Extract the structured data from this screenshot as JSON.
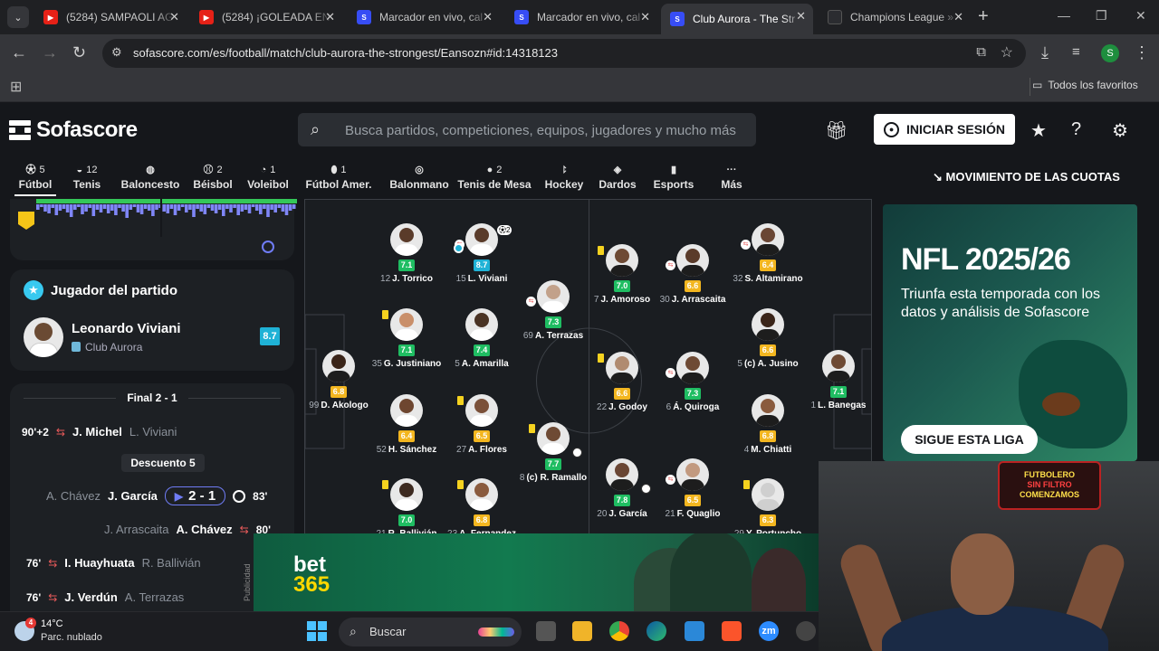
{
  "browser": {
    "tabs": [
      {
        "title": "(5284) SAMPAOLI AG",
        "icon": "youtube-icon"
      },
      {
        "title": "(5284) ¡GOLEADA EN",
        "icon": "youtube-icon"
      },
      {
        "title": "Marcador en vivo, cal",
        "icon": "sofascore-icon"
      },
      {
        "title": "Marcador en vivo, cal",
        "icon": "sofascore-icon"
      },
      {
        "title": "Club Aurora - The Str",
        "icon": "sofascore-icon",
        "active": true
      },
      {
        "title": "Champions League »",
        "icon": "champions-icon"
      }
    ],
    "url": "sofascore.com/es/football/match/club-aurora-the-strongest/Eansozn#id:14318123",
    "profile_initial": "S",
    "bookmarks_folder": "Todos los favoritos"
  },
  "header": {
    "logo": "Sofascore",
    "search_placeholder": "Busca partidos, competiciones, equipos, jugadores y mucho más",
    "login_label": "INICIAR SESIÓN"
  },
  "sports": [
    {
      "label": "Fútbol",
      "count": "5",
      "icon": "football-icon",
      "active": true
    },
    {
      "label": "Tenis",
      "count": "12",
      "icon": "tennis-icon"
    },
    {
      "label": "Baloncesto",
      "count": "",
      "icon": "basketball-icon"
    },
    {
      "label": "Béisbol",
      "count": "2",
      "icon": "baseball-icon"
    },
    {
      "label": "Voleibol",
      "count": "1",
      "icon": "volleyball-icon"
    },
    {
      "label": "Fútbol Amer.",
      "count": "1",
      "icon": "american-football-icon"
    },
    {
      "label": "Balonmano",
      "count": "",
      "icon": "handball-icon"
    },
    {
      "label": "Tenis de Mesa",
      "count": "2",
      "icon": "table-tennis-icon"
    },
    {
      "label": "Hockey",
      "count": "",
      "icon": "hockey-icon"
    },
    {
      "label": "Dardos",
      "count": "",
      "icon": "darts-icon"
    },
    {
      "label": "Esports",
      "count": "",
      "icon": "esports-icon"
    },
    {
      "label": "Más",
      "count": "",
      "icon": "more-icon"
    }
  ],
  "odds_label": "MOVIMIENTO DE LAS CUOTAS",
  "player_of_match": {
    "title": "Jugador del partido",
    "name": "Leonardo Viviani",
    "club": "Club Aurora",
    "rating": "8.7"
  },
  "events": {
    "final": "Final 2 - 1",
    "descuento": "Descuento 5",
    "rows": [
      {
        "minute": "90'+2",
        "in": "J. Michel",
        "out": "L. Viviani",
        "type": "sub"
      },
      {
        "minute": "83'",
        "scorer": "J. García",
        "assist": "A. Chávez",
        "score": "2 - 1",
        "type": "goal"
      },
      {
        "minute": "80'",
        "in": "A. Chávez",
        "out": "J. Arrascaita",
        "type": "sub"
      },
      {
        "minute": "76'",
        "in": "I. Huayhuata",
        "out": "R. Ballivián",
        "type": "sub"
      },
      {
        "minute": "76'",
        "in": "J. Verdún",
        "out": "A. Terrazas",
        "type": "sub"
      }
    ]
  },
  "publicidad": "Publicidad",
  "lineup": {
    "home_color": "#f5f5f5",
    "away_color": "#f5c518",
    "players": [
      {
        "no": "99",
        "name": "D. Akologo",
        "rating": "6.8",
        "rc": "#f3b61f",
        "skin": "#3a2418",
        "kit": "#1d1d1d"
      },
      {
        "no": "12",
        "name": "J. Torrico",
        "rating": "7.1",
        "rc": "#1fbd62",
        "skin": "#5a3b2a",
        "kit": "#ffffff"
      },
      {
        "no": "35",
        "name": "G. Justiniano",
        "rating": "7.1",
        "rc": "#1fbd62",
        "skin": "#c98f6a",
        "kit": "#ffffff"
      },
      {
        "no": "52",
        "name": "H. Sánchez",
        "rating": "6.4",
        "rc": "#f3b61f",
        "skin": "#6e4630",
        "kit": "#ffffff"
      },
      {
        "no": "21",
        "name": "R. Ballivián",
        "rating": "7.0",
        "rc": "#1fbd62",
        "skin": "#3d2a20",
        "kit": "#ffffff"
      },
      {
        "no": "15",
        "name": "L. Viviani",
        "rating": "8.7",
        "rc": "#1fb2d6",
        "skin": "#5a3b2a",
        "kit": "#ffffff"
      },
      {
        "no": "5",
        "name": "A. Amarilla",
        "rating": "7.4",
        "rc": "#1fbd62",
        "skin": "#4a3324",
        "kit": "#ffffff"
      },
      {
        "no": "27",
        "name": "A. Flores",
        "rating": "6.5",
        "rc": "#f3b61f",
        "skin": "#7a5039",
        "kit": "#ffffff"
      },
      {
        "no": "23",
        "name": "A. Fernandez",
        "rating": "6.8",
        "rc": "#f3b61f",
        "skin": "#8a5b3e",
        "kit": "#ffffff"
      },
      {
        "no": "69",
        "name": "A. Terrazas",
        "rating": "7.3",
        "rc": "#1fbd62",
        "skin": "#c2a18a",
        "kit": "#ffffff"
      },
      {
        "no": "8",
        "name": "(c) R. Ramallo",
        "rating": "7.7",
        "rc": "#1fbd62",
        "skin": "#6e4a34",
        "kit": "#ffffff"
      },
      {
        "no": "7",
        "name": "J. Amoroso",
        "rating": "7.0",
        "rc": "#1fbd62",
        "skin": "#6e4a34",
        "kit": "#1d1d1d"
      },
      {
        "no": "22",
        "name": "J. Godoy",
        "rating": "6.6",
        "rc": "#f3b61f",
        "skin": "#b08b70",
        "kit": "#1d1d1d"
      },
      {
        "no": "20",
        "name": "J. García",
        "rating": "7.8",
        "rc": "#1fbd62",
        "skin": "#6a4634",
        "kit": "#1d1d1d"
      },
      {
        "no": "30",
        "name": "J. Arrascaita",
        "rating": "6.6",
        "rc": "#f3b61f",
        "skin": "#5a3b2a",
        "kit": "#1d1d1d"
      },
      {
        "no": "6",
        "name": "Á. Quiroga",
        "rating": "7.3",
        "rc": "#1fbd62",
        "skin": "#6e4a34",
        "kit": "#1d1d1d"
      },
      {
        "no": "21",
        "name": "F. Quaglio",
        "rating": "6.5",
        "rc": "#f3b61f",
        "skin": "#c29a80",
        "kit": "#1d1d1d"
      },
      {
        "no": "32",
        "name": "S. Altamirano",
        "rating": "6.4",
        "rc": "#f3b61f",
        "skin": "#6a4634",
        "kit": "#1d1d1d"
      },
      {
        "no": "5",
        "name": "(c) A. Jusino",
        "rating": "6.6",
        "rc": "#f3b61f",
        "skin": "#3a2418",
        "kit": "#1d1d1d"
      },
      {
        "no": "4",
        "name": "M. Chiatti",
        "rating": "6.8",
        "rc": "#f3b61f",
        "skin": "#8a5b3e",
        "kit": "#1d1d1d"
      },
      {
        "no": "29",
        "name": "Y. Portuncho",
        "rating": "6.3",
        "rc": "#f3b61f",
        "skin": "#cfcfcf",
        "kit": "#cfcfcf"
      },
      {
        "no": "1",
        "name": "L. Banegas",
        "rating": "7.1",
        "rc": "#1fbd62",
        "skin": "#6e4a34",
        "kit": "#1d1d1d"
      }
    ]
  },
  "ad_right": {
    "title": "NFL 2025/26",
    "text": "Triunfa esta temporada con los datos y análisis de Sofascore",
    "button": "SIGUE ESTA LIGA"
  },
  "bet_ad": {
    "line1": "bet",
    "line2": "365"
  },
  "webcam": {
    "sign_line1": "FUTBOLERO",
    "sign_line2": "SIN FILTRO",
    "sign_line3": "COMENZAMOS"
  },
  "taskbar": {
    "temp": "14°C",
    "weather": "Parc. nublado",
    "weather_badge": "4",
    "search": "Buscar"
  }
}
